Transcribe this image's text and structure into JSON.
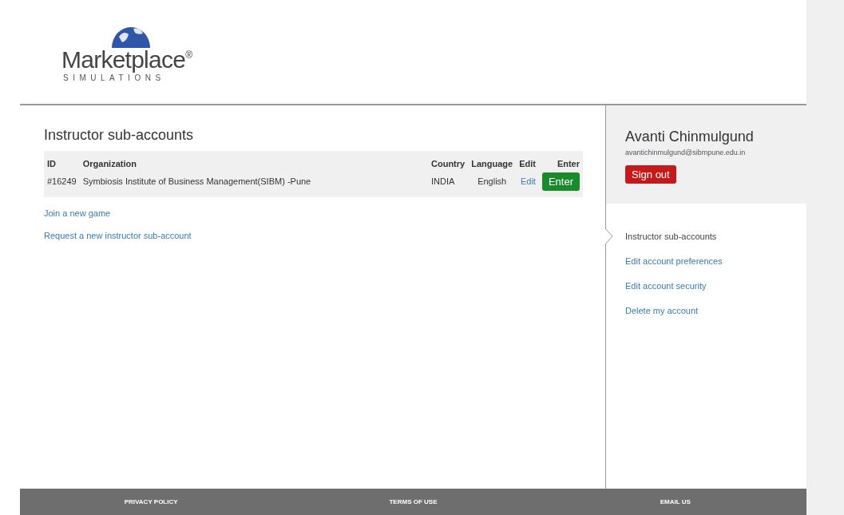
{
  "logo": {
    "name": "Marketplace",
    "mark": "®",
    "tagline": "SIMULATIONS"
  },
  "main": {
    "title": "Instructor sub-accounts",
    "table": {
      "columns": [
        "ID",
        "Organization",
        "Country",
        "Language",
        "Edit",
        "Enter"
      ],
      "rows": [
        {
          "id": "#16249",
          "organization": "Symbiosis Institute of Business Management(SIBM) -Pune",
          "country": "INDIA",
          "language": "English",
          "edit": "Edit",
          "enter": "Enter"
        }
      ]
    },
    "links": [
      "Join a new game",
      "Request a new instructor sub-account"
    ]
  },
  "account": {
    "name": "Avanti Chinmulgund",
    "email": "avantichinmulgund@sibmpune.edu.in",
    "sign_out": "Sign out"
  },
  "nav": [
    {
      "label": "Instructor sub-accounts",
      "selected": true
    },
    {
      "label": "Edit account preferences",
      "selected": false
    },
    {
      "label": "Edit account security",
      "selected": false
    },
    {
      "label": "Delete my account",
      "selected": false
    }
  ],
  "footer": [
    "PRIVACY POLICY",
    "TERMS OF USE",
    "EMAIL US"
  ]
}
